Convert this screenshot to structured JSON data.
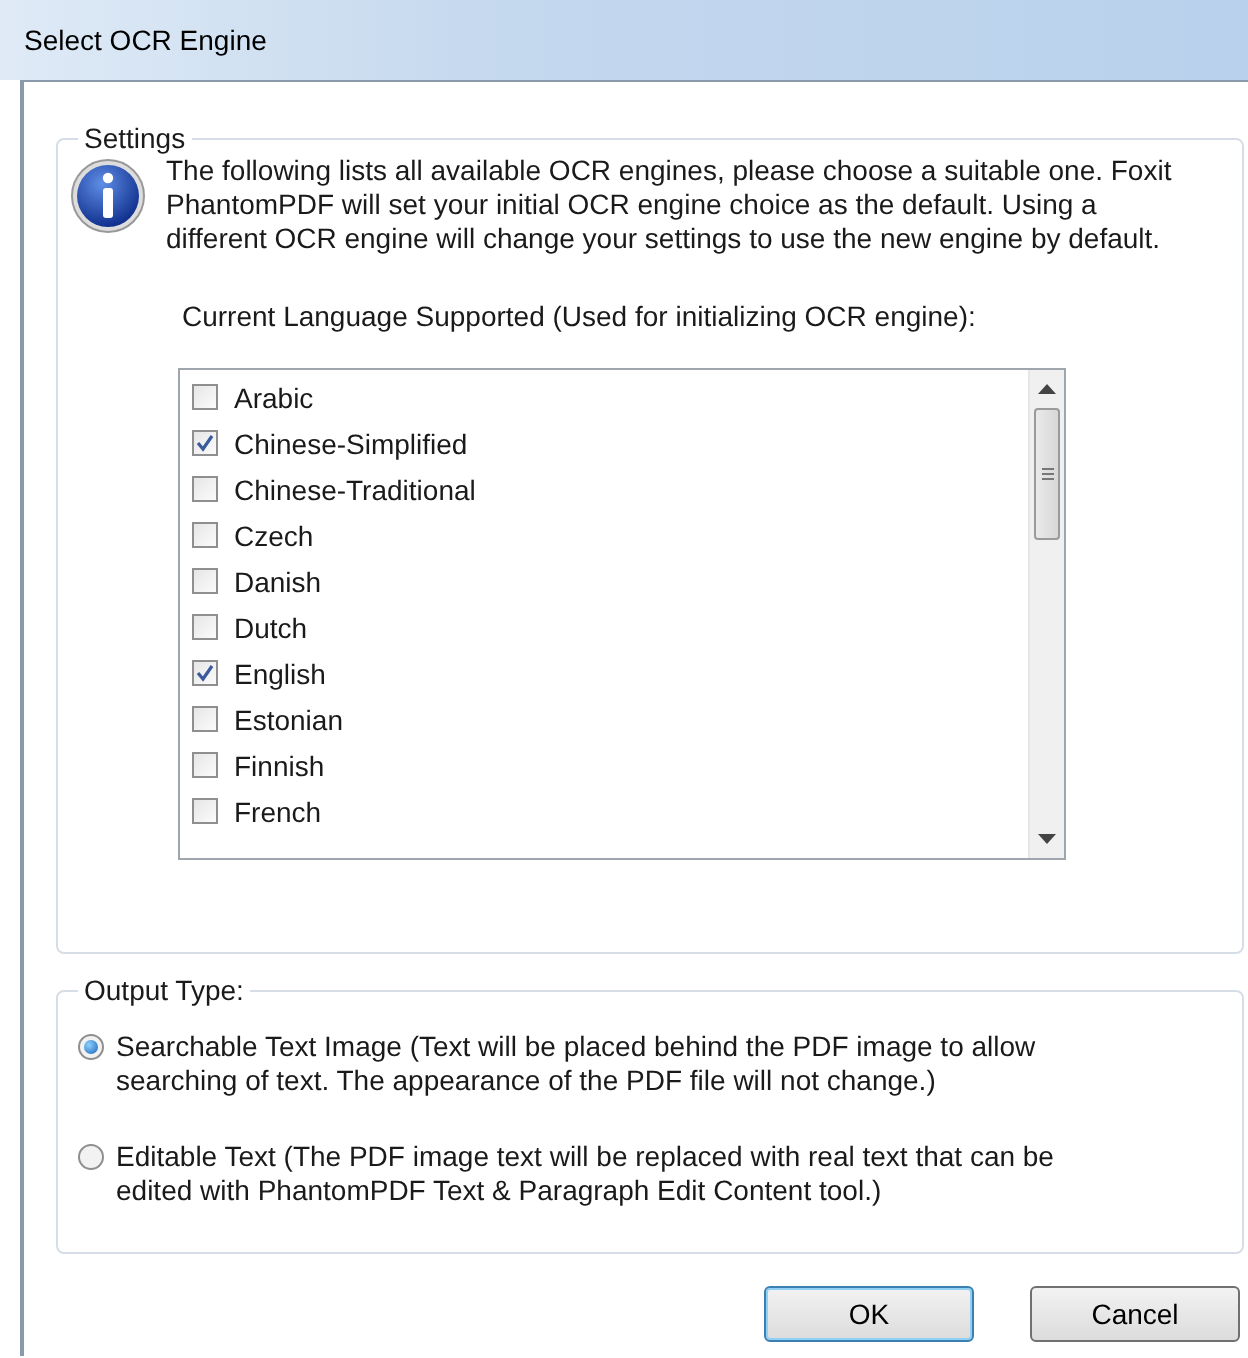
{
  "window": {
    "title": "Select OCR Engine"
  },
  "settings": {
    "title": "Settings",
    "description": "The following lists all available OCR engines, please choose a suitable one. Foxit PhantomPDF will set your initial OCR engine choice as the default. Using a different OCR engine will change your settings to use the new engine by default.",
    "languages_label": "Current Language Supported (Used for initializing OCR engine):",
    "languages": [
      {
        "label": "Arabic",
        "checked": false
      },
      {
        "label": "Chinese-Simplified",
        "checked": true
      },
      {
        "label": "Chinese-Traditional",
        "checked": false
      },
      {
        "label": "Czech",
        "checked": false
      },
      {
        "label": "Danish",
        "checked": false
      },
      {
        "label": "Dutch",
        "checked": false
      },
      {
        "label": "English",
        "checked": true
      },
      {
        "label": "Estonian",
        "checked": false
      },
      {
        "label": "Finnish",
        "checked": false
      },
      {
        "label": "French",
        "checked": false
      }
    ]
  },
  "output_type": {
    "title": "Output Type:",
    "options": [
      {
        "label": "Searchable Text Image (Text will be placed behind the PDF image to allow searching of text. The appearance of the PDF file will not change.)",
        "selected": true
      },
      {
        "label": "Editable Text (The PDF image text will be replaced with real text that can be edited with PhantomPDF Text & Paragraph Edit Content tool.)",
        "selected": false
      }
    ]
  },
  "buttons": [
    {
      "label": "OK",
      "kind": "default"
    },
    {
      "label": "Cancel",
      "kind": "normal"
    }
  ]
}
